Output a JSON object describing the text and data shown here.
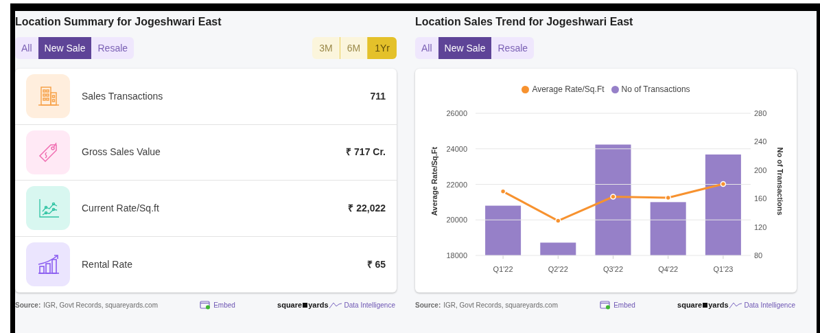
{
  "summary": {
    "title": "Location Summary for Jogeshwari East",
    "type_tabs": [
      {
        "label": "All",
        "selected": false
      },
      {
        "label": "New Sale",
        "selected": true
      },
      {
        "label": "Resale",
        "selected": false
      }
    ],
    "period_tabs": [
      {
        "label": "3M",
        "selected": false
      },
      {
        "label": "6M",
        "selected": false
      },
      {
        "label": "1Yr",
        "selected": true
      }
    ],
    "metrics": [
      {
        "kind": "building",
        "label": "Sales Transactions",
        "value": "711"
      },
      {
        "kind": "tag",
        "label": "Gross Sales Value",
        "value": "₹ 717 Cr."
      },
      {
        "kind": "trend",
        "label": "Current Rate/Sq.ft",
        "value": "₹ 22,022"
      },
      {
        "kind": "growth",
        "label": "Rental Rate",
        "value": "₹ 65"
      }
    ],
    "footer": {
      "source_label": "Source:",
      "source": "IGR, Govt Records, squareyards.com",
      "embed": "Embed",
      "brand_left": "square",
      "brand_right": "yards",
      "brand_tag": "Data Intelligence"
    }
  },
  "trend": {
    "title": "Location Sales Trend for Jogeshwari East",
    "type_tabs": [
      {
        "label": "All",
        "selected": false
      },
      {
        "label": "New Sale",
        "selected": true
      },
      {
        "label": "Resale",
        "selected": false
      }
    ],
    "rate_chart": {
      "chart_data": {
        "type": "line",
        "ylabel": "Average Rate/Sq.Ft",
        "yticks": [
          18000,
          20000,
          22000,
          24000,
          26000
        ],
        "ylim": [
          18000,
          26000
        ],
        "grid": true,
        "series": [
          {
            "name": "Average Rate/Sq.Ft",
            "color": "#f7922f",
            "marker": "circle",
            "values": [
              21600,
              19950,
              21300,
              21250,
              22022
            ]
          }
        ]
      }
    },
    "transactions_chart": {
      "chart_data": {
        "type": "bar",
        "categories": [
          "Q1'22",
          "Q2'22",
          "Q3'22",
          "Q4'22",
          "Q1'23"
        ],
        "ylabel": "No of Transactions",
        "yticks": [
          80,
          120,
          160,
          200,
          240,
          280
        ],
        "ylim": [
          80,
          280
        ],
        "series": [
          {
            "name": "No of Transactions",
            "color": "#9680c8",
            "values": [
              150,
              98,
              236,
              155,
              222
            ]
          }
        ]
      }
    },
    "footer": {
      "source_label": "Source:",
      "source": "IGR, Govt Records, squareyards.com",
      "embed": "Embed",
      "brand_left": "square",
      "brand_right": "yards",
      "brand_tag": "Data Intelligence"
    }
  }
}
